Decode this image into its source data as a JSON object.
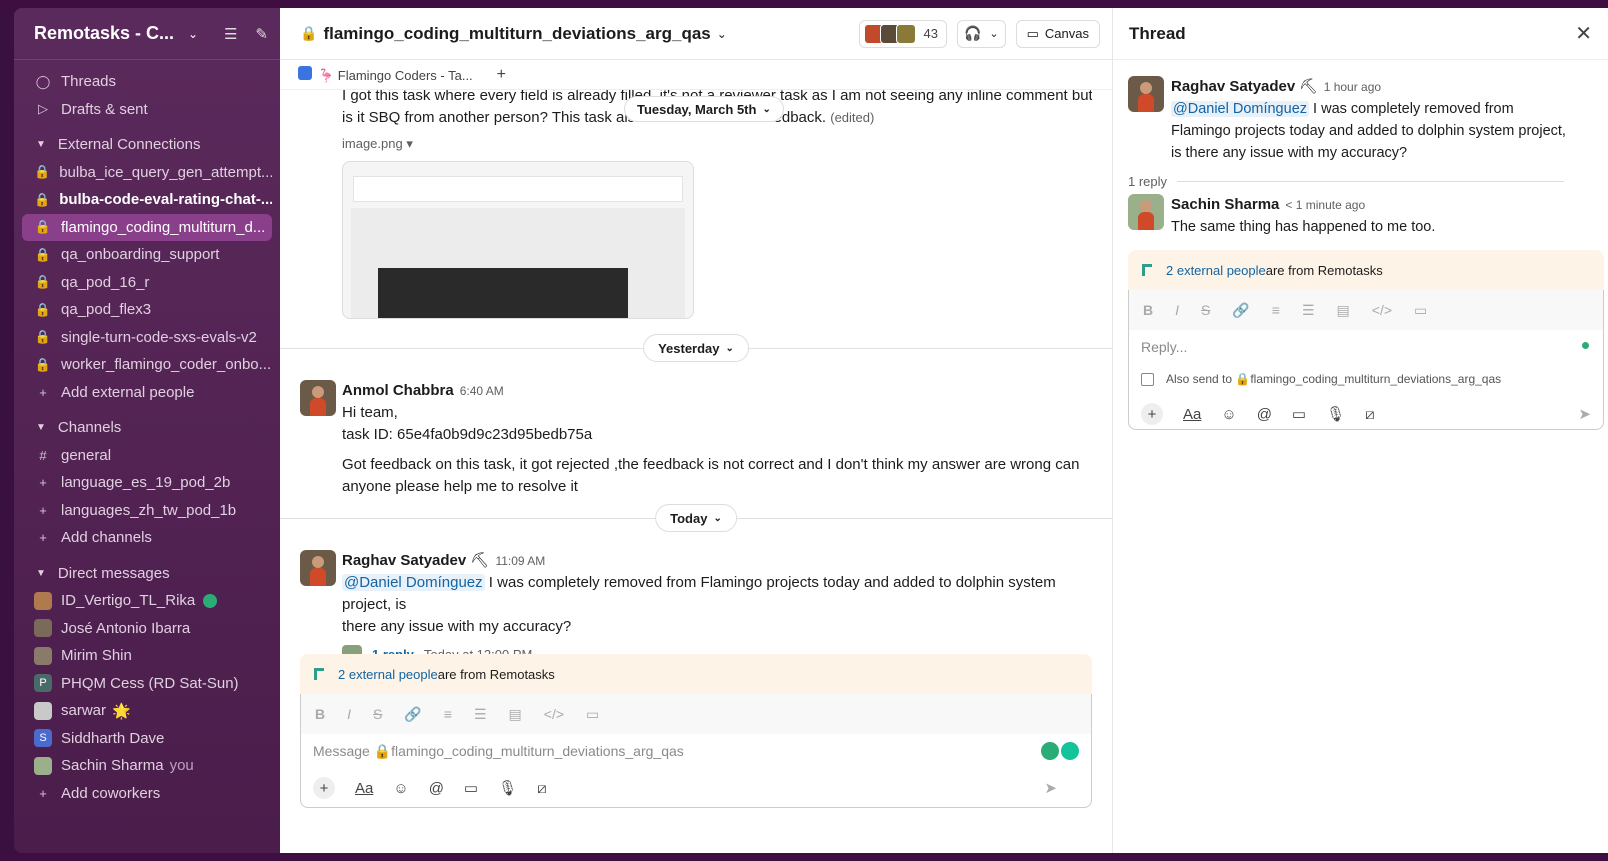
{
  "workspace": {
    "name": "Remotasks - C...",
    "chevron": "⌄"
  },
  "sidebar": {
    "top": [
      {
        "label": "Threads",
        "icon": "threads-icon"
      },
      {
        "label": "Drafts & sent",
        "icon": "send-icon"
      }
    ],
    "external": {
      "title": "External Connections",
      "items": [
        {
          "label": "bulba_ice_query_gen_attempt...",
          "bold": false
        },
        {
          "label": "bulba-code-eval-rating-chat-...",
          "bold": true
        },
        {
          "label": "flamingo_coding_multiturn_d...",
          "active": true
        },
        {
          "label": "qa_onboarding_support"
        },
        {
          "label": "qa_pod_16_r"
        },
        {
          "label": "qa_pod_flex3"
        },
        {
          "label": "single-turn-code-sxs-evals-v2"
        },
        {
          "label": "worker_flamingo_coder_onbo..."
        }
      ],
      "add": "Add external people"
    },
    "channels": {
      "title": "Channels",
      "items": [
        {
          "label": "general",
          "icon": "#"
        },
        {
          "label": "language_es_19_pod_2b",
          "icon": "+"
        },
        {
          "label": "languages_zh_tw_pod_1b",
          "icon": "+"
        }
      ],
      "add": "Add channels"
    },
    "dms": {
      "title": "Direct messages",
      "items": [
        {
          "label": "ID_Vertigo_TL_Rika",
          "color": "#b07a4e"
        },
        {
          "label": "José Antonio Ibarra",
          "color": "#7a6a5a"
        },
        {
          "label": "Mirim Shin",
          "color": "#8a7a6a"
        },
        {
          "label": "PHQM Cess (RD Sat-Sun)",
          "color": "#4a6a6a",
          "initial": "P"
        },
        {
          "label": "sarwar",
          "color": "#c9c9c9",
          "star": "🌟"
        },
        {
          "label": "Siddharth Dave",
          "color": "#4a6ad0",
          "initial": "S"
        },
        {
          "label": "Sachin Sharma",
          "color": "#9ab08a",
          "you": "you"
        }
      ],
      "add": "Add coworkers"
    }
  },
  "channel": {
    "title": "flamingo_coding_multiturn_deviations_arg_qas",
    "member_count": "43",
    "canvas_label": "Canvas",
    "tab": "🦩 Flamingo Coders - Ta...",
    "add_tab": "+"
  },
  "messages": {
    "top_text_1": "I got this task where every field is already filled, it's not a reviewer task as I am not seeing any inline comment button,",
    "top_text_2": "is it SBQ from another person? This task also",
    "top_text_3": "edback.",
    "edited": "(edited)",
    "image_name": "image.png",
    "date_pill": "Tuesday, March 5th",
    "yesterday": "Yesterday",
    "today": "Today",
    "anmol": {
      "author": "Anmol Chabbra",
      "time": "6:40 AM",
      "line1": "Hi team,",
      "line2": "task ID: 65e4fa0b9d9c23d95bedb75a",
      "line3": "Got feedback on this task, it got rejected ,the feedback is not correct and I don't think my answer are wrong can",
      "line4": "anyone please help me to resolve it"
    },
    "raghav": {
      "author": "Raghav Satyadev",
      "badge": "⛏",
      "time": "11:09 AM",
      "mention": "@Daniel Domínguez",
      "text1": " I was completely removed from Flamingo projects today and added to dolphin system project, is",
      "text2": "there any issue with my accuracy?",
      "reply_count": "1 reply",
      "reply_time": "Today at 12:00 PM"
    }
  },
  "composer": {
    "ext_count": "2 external people",
    "ext_text": " are from Remotasks",
    "placeholder": "Message 🔒flamingo_coding_multiturn_deviations_arg_qas"
  },
  "thread": {
    "title": "Thread",
    "parent": {
      "author": "Raghav Satyadev",
      "badge": "⛏",
      "time": "1 hour ago",
      "mention": "@Daniel Domínguez",
      "text1": " I was completely removed from",
      "text2": "Flamingo projects today and added to dolphin system project,",
      "text3": "is there any issue with my accuracy?"
    },
    "reply_count": "1 reply",
    "reply": {
      "author": "Sachin Sharma",
      "time": "< 1 minute ago",
      "text": "The same thing has happened to me too."
    },
    "ext_count": "2 external people",
    "ext_text": " are from Remotasks",
    "placeholder": "Reply...",
    "also_send": "Also send to 🔒flamingo_coding_multiturn_deviations_arg_qas"
  }
}
